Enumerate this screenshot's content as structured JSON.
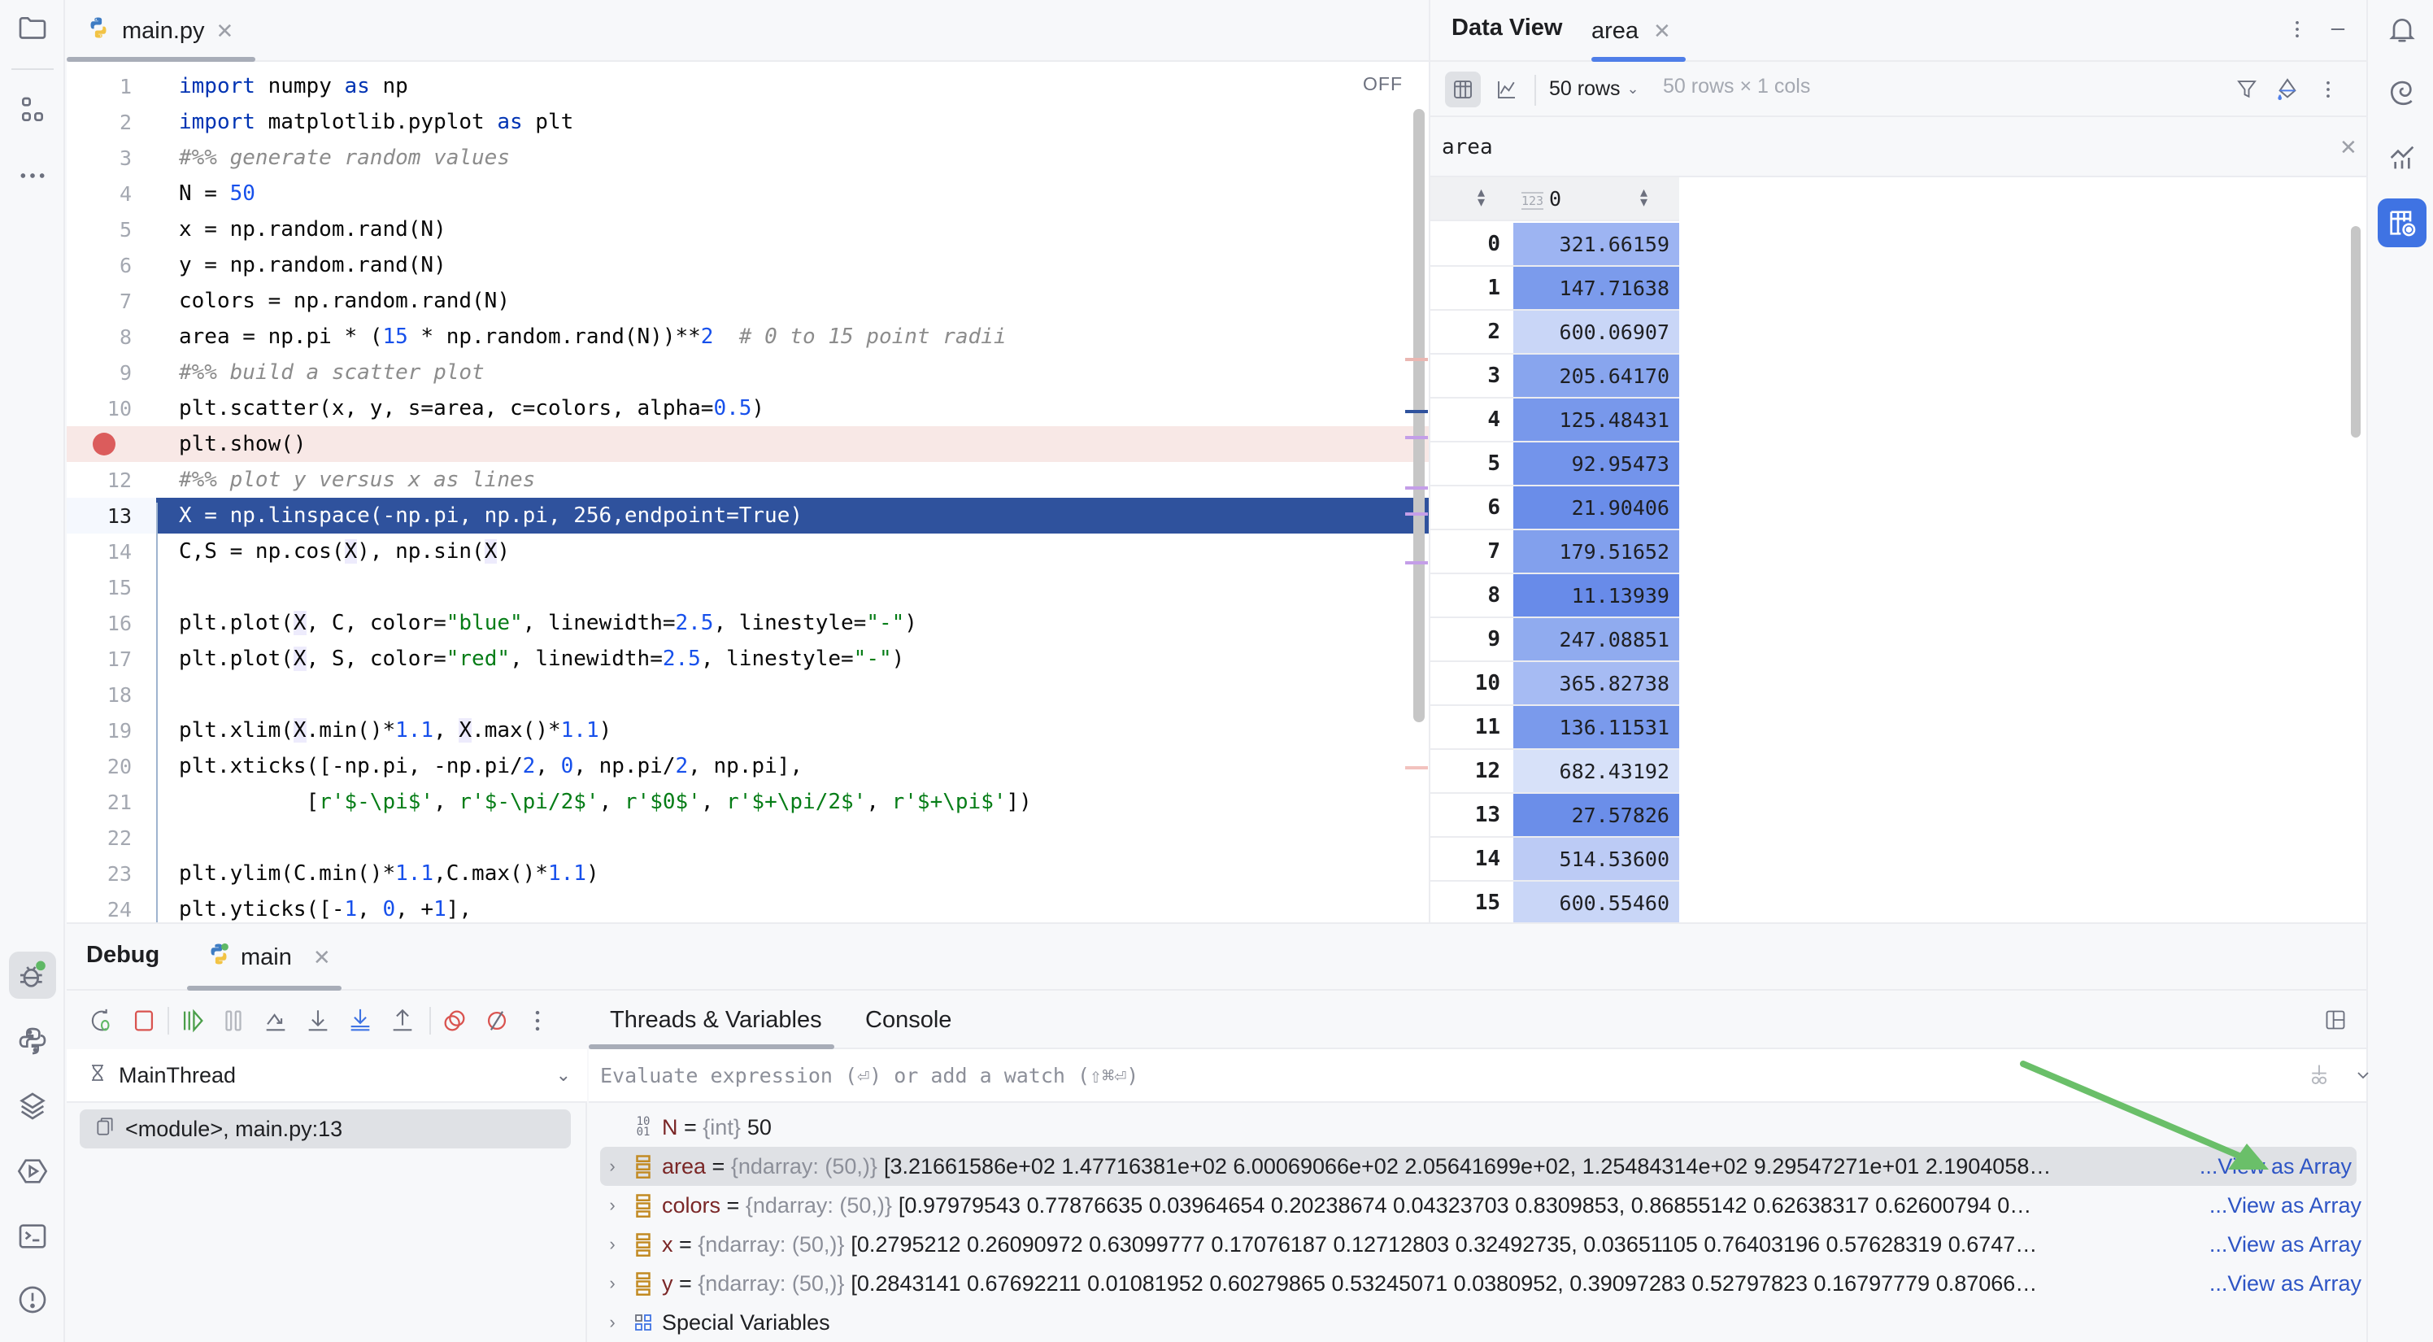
{
  "left_bar": {
    "icons": [
      "folder-icon",
      "structure-icon",
      "more-icon"
    ],
    "bottom_icons": [
      "debug-icon",
      "python-console-icon",
      "layers-icon",
      "services-icon",
      "terminal-icon",
      "problems-icon"
    ]
  },
  "editor": {
    "tab": {
      "label": "main.py",
      "active": true
    },
    "inspection_status": "OFF",
    "current_line": 13,
    "breakpoint_line": 11,
    "lines": [
      {
        "n": "1",
        "tokens": [
          [
            "kw",
            "import"
          ],
          [
            "",
            " numpy "
          ],
          [
            "kw",
            "as"
          ],
          [
            "",
            " np"
          ]
        ]
      },
      {
        "n": "2",
        "tokens": [
          [
            "kw",
            "import"
          ],
          [
            "",
            " matplotlib.pyplot "
          ],
          [
            "kw",
            "as"
          ],
          [
            "",
            " plt"
          ]
        ]
      },
      {
        "n": "3",
        "tokens": [
          [
            "cm",
            "#%% generate random values"
          ]
        ]
      },
      {
        "n": "4",
        "tokens": [
          [
            "",
            "N = "
          ],
          [
            "num",
            "50"
          ]
        ]
      },
      {
        "n": "5",
        "tokens": [
          [
            "",
            "x = np.random.rand(N)"
          ]
        ]
      },
      {
        "n": "6",
        "tokens": [
          [
            "",
            "y = np.random.rand(N)"
          ]
        ]
      },
      {
        "n": "7",
        "tokens": [
          [
            "",
            "colors = np.random.rand(N)"
          ]
        ]
      },
      {
        "n": "8",
        "tokens": [
          [
            "",
            "area = np.pi * ("
          ],
          [
            "num",
            "15"
          ],
          [
            "",
            " * np.random.rand(N))**"
          ],
          [
            "num",
            "2"
          ],
          [
            "",
            "  "
          ],
          [
            "cm",
            "# 0 to 15 point radii"
          ]
        ]
      },
      {
        "n": "9",
        "tokens": [
          [
            "cm",
            "#%% build a scatter plot"
          ]
        ]
      },
      {
        "n": "10",
        "tokens": [
          [
            "",
            "plt.scatter(x, y, s=area, c=colors, alpha="
          ],
          [
            "num",
            "0.5"
          ],
          [
            "",
            ")"
          ]
        ]
      },
      {
        "n": "",
        "tokens": [
          [
            "",
            "plt.show()"
          ]
        ]
      },
      {
        "n": "12",
        "tokens": [
          [
            "cm",
            "#%% plot y versus x as lines"
          ]
        ]
      },
      {
        "n": "13",
        "tokens": [
          [
            "",
            "X = np.linspace(-np.pi, np.pi, 256,endpoint=True)"
          ]
        ]
      },
      {
        "n": "14",
        "tokens": [
          [
            "",
            "C,S = np.cos("
          ],
          [
            "ref",
            "X"
          ],
          [
            "",
            "), np.sin("
          ],
          [
            "ref",
            "X"
          ],
          [
            "",
            ")"
          ]
        ]
      },
      {
        "n": "15",
        "tokens": []
      },
      {
        "n": "16",
        "tokens": [
          [
            "",
            "plt.plot("
          ],
          [
            "ref",
            "X"
          ],
          [
            "",
            ", C, color="
          ],
          [
            "str",
            "\"blue\""
          ],
          [
            "",
            ", linewidth="
          ],
          [
            "num",
            "2.5"
          ],
          [
            "",
            ", linestyle="
          ],
          [
            "str",
            "\"-\""
          ],
          [
            "",
            ")"
          ]
        ]
      },
      {
        "n": "17",
        "tokens": [
          [
            "",
            "plt.plot("
          ],
          [
            "ref",
            "X"
          ],
          [
            "",
            ", S, color="
          ],
          [
            "str",
            "\"red\""
          ],
          [
            "",
            ", linewidth="
          ],
          [
            "num",
            "2.5"
          ],
          [
            "",
            ", linestyle="
          ],
          [
            "str",
            "\"-\""
          ],
          [
            "",
            ")"
          ]
        ]
      },
      {
        "n": "18",
        "tokens": []
      },
      {
        "n": "19",
        "tokens": [
          [
            "",
            "plt.xlim("
          ],
          [
            "ref",
            "X"
          ],
          [
            "",
            ".min()*"
          ],
          [
            "num",
            "1.1"
          ],
          [
            "",
            ", "
          ],
          [
            "ref",
            "X"
          ],
          [
            "",
            ".max()*"
          ],
          [
            "num",
            "1.1"
          ],
          [
            "",
            ")"
          ]
        ]
      },
      {
        "n": "20",
        "tokens": [
          [
            "",
            "plt.xticks([-np.pi, -np.pi/"
          ],
          [
            "num",
            "2"
          ],
          [
            "",
            ", "
          ],
          [
            "num",
            "0"
          ],
          [
            "",
            ", np.pi/"
          ],
          [
            "num",
            "2"
          ],
          [
            "",
            ", np.pi],"
          ]
        ]
      },
      {
        "n": "21",
        "tokens": [
          [
            "",
            "          ["
          ],
          [
            "str",
            "r'$-\\pi$'"
          ],
          [
            "",
            ", "
          ],
          [
            "str",
            "r'$-\\pi/2$'"
          ],
          [
            "",
            ", "
          ],
          [
            "str",
            "r'$0$'"
          ],
          [
            "",
            ", "
          ],
          [
            "str",
            "r'$+\\pi/2$'"
          ],
          [
            "",
            ", "
          ],
          [
            "str",
            "r'$+\\pi$'"
          ],
          [
            "",
            "])"
          ]
        ]
      },
      {
        "n": "22",
        "tokens": []
      },
      {
        "n": "23",
        "tokens": [
          [
            "",
            "plt.ylim(C.min()*"
          ],
          [
            "num",
            "1.1"
          ],
          [
            "",
            ",C.max()*"
          ],
          [
            "num",
            "1.1"
          ],
          [
            "",
            ")"
          ]
        ]
      },
      {
        "n": "24",
        "tokens": [
          [
            "",
            "plt.yticks([-"
          ],
          [
            "num",
            "1"
          ],
          [
            "",
            ", "
          ],
          [
            "num",
            "0"
          ],
          [
            "",
            ", +"
          ],
          [
            "num",
            "1"
          ],
          [
            "",
            "],"
          ]
        ]
      }
    ]
  },
  "data_view": {
    "title": "Data View",
    "tab_label": "area",
    "rows_selector": "50 rows",
    "shape_label": "50 rows × 1 cols",
    "filter_value": "area",
    "column_header": "0",
    "column_type_badge": "123",
    "rows": [
      {
        "index": "0",
        "value": "321.66159",
        "shade": "#9db4f2"
      },
      {
        "index": "1",
        "value": "147.71638",
        "shade": "#7b9bec"
      },
      {
        "index": "2",
        "value": "600.06907",
        "shade": "#c9d6f7"
      },
      {
        "index": "3",
        "value": "205.64170",
        "shade": "#88a5ee"
      },
      {
        "index": "4",
        "value": "125.48431",
        "shade": "#7898eb"
      },
      {
        "index": "5",
        "value": "92.95473",
        "shade": "#7394eb"
      },
      {
        "index": "6",
        "value": "21.90406",
        "shade": "#6a8de9"
      },
      {
        "index": "7",
        "value": "179.51652",
        "shade": "#82a0ed"
      },
      {
        "index": "8",
        "value": "11.13939",
        "shade": "#688be9"
      },
      {
        "index": "9",
        "value": "247.08851",
        "shade": "#90abef"
      },
      {
        "index": "10",
        "value": "365.82738",
        "shade": "#a6bbf3"
      },
      {
        "index": "11",
        "value": "136.11531",
        "shade": "#7a9aec"
      },
      {
        "index": "12",
        "value": "682.43192",
        "shade": "#d7e1f9"
      },
      {
        "index": "13",
        "value": "27.57826",
        "shade": "#6b8ee9"
      },
      {
        "index": "14",
        "value": "514.53600",
        "shade": "#bccbf5"
      },
      {
        "index": "15",
        "value": "600.55460",
        "shade": "#c9d6f7"
      }
    ]
  },
  "right_bar": {
    "icons": [
      "notifications-icon",
      "ai-assistant-icon",
      "sciview-icon",
      "data-view-icon"
    ]
  },
  "debug": {
    "title": "Debug",
    "session_tab": "main",
    "tabs": [
      "Threads & Variables",
      "Console"
    ],
    "active_tab": "Threads & Variables",
    "thread": "MainThread",
    "frame": "<module>, main.py:13",
    "eval_placeholder": "Evaluate expression (⏎) or add a watch (⇧⌘⏎)",
    "variables": [
      {
        "name": "N",
        "type": "{int}",
        "value": "50",
        "icon": "int",
        "expandable": false
      },
      {
        "name": "area",
        "type": "{ndarray: (50,)}",
        "value": "[3.21661586e+02 1.47716381e+02 6.00069066e+02 2.05641699e+02, 1.25484314e+02 9.29547271e+01 2.1904058…",
        "link": "...View as Array",
        "selected": true
      },
      {
        "name": "colors",
        "type": "{ndarray: (50,)}",
        "value": "[0.97979543 0.77876635 0.03964654 0.20238674 0.04323703 0.8309853, 0.86855142 0.62638317 0.62600794 0…",
        "link": "...View as Array"
      },
      {
        "name": "x",
        "type": "{ndarray: (50,)}",
        "value": "[0.2795212  0.26090972 0.63099777 0.17076187 0.12712803 0.32492735, 0.03651105 0.76403196 0.57628319 0.6747…",
        "link": "...View as Array"
      },
      {
        "name": "y",
        "type": "{ndarray: (50,)}",
        "value": "[0.2843141  0.67692211 0.01081952 0.60279865 0.53245071 0.0380952, 0.39097283 0.52797823 0.16797779 0.87066…",
        "link": "...View as Array"
      },
      {
        "name": "Special Variables",
        "type": "",
        "value": "",
        "icon": "special"
      }
    ]
  },
  "annotation": {
    "type": "arrow",
    "color": "#6abf69",
    "points_to": "area View as Array link"
  }
}
